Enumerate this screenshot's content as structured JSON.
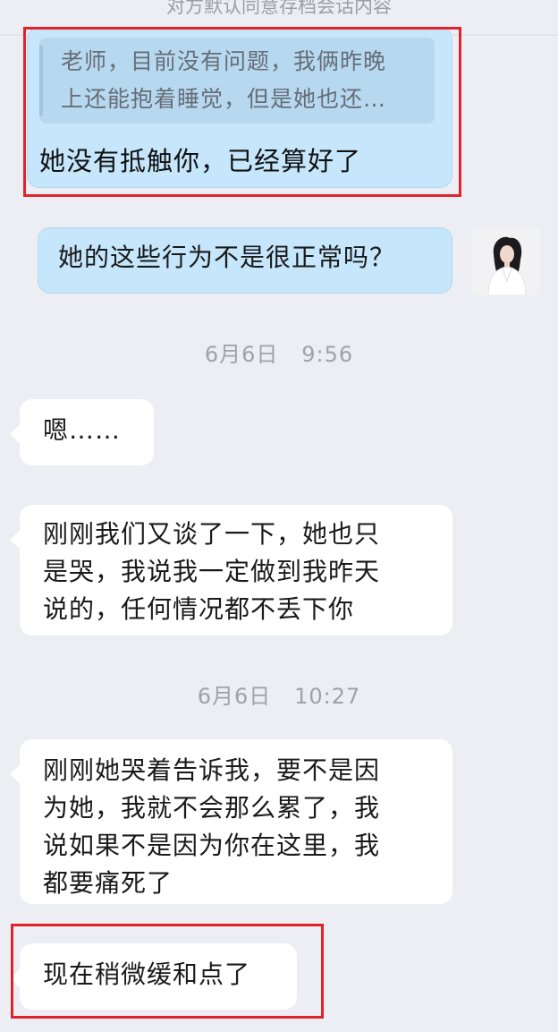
{
  "header": {
    "archive_notice": "对方默认同意存档会话内容"
  },
  "messages": [
    {
      "side": "mine",
      "quote_lines": [
        "老师，目前没有问题，我俩昨晚",
        "上还能抱着睡觉，但是她也还…"
      ],
      "text_lines": [
        "她没有抵触你，已经算好了"
      ],
      "highlighted": true
    },
    {
      "side": "mine",
      "text_lines": [
        "她的这些行为不是很正常吗？"
      ],
      "has_avatar": true
    },
    {
      "type": "timestamp",
      "text": "6月6日   9:56"
    },
    {
      "side": "theirs",
      "text_lines": [
        "嗯……"
      ]
    },
    {
      "side": "theirs",
      "text_lines": [
        "刚刚我们又谈了一下，她也只",
        "是哭，我说我一定做到我昨天",
        "说的，任何情况都不丢下你"
      ]
    },
    {
      "type": "timestamp",
      "text": "6月6日   10:27"
    },
    {
      "side": "theirs",
      "text_lines": [
        "刚刚她哭着告诉我，要不是因",
        "为她，我就不会那么累了，我",
        "说如果不是因为你在这里，我",
        "都要痛死了"
      ]
    },
    {
      "side": "theirs",
      "text_lines": [
        "现在稍微缓和点了"
      ],
      "highlighted": true
    }
  ],
  "colors": {
    "page_background": "#eceef3",
    "mine_bubble": "#c5e6fb",
    "theirs_bubble": "#ffffff",
    "quote_background": "#b6d9f0",
    "highlight_border": "#e0232a",
    "timestamp_text": "#9fa2a9"
  },
  "icons": {
    "avatar": "user-avatar-photo"
  }
}
